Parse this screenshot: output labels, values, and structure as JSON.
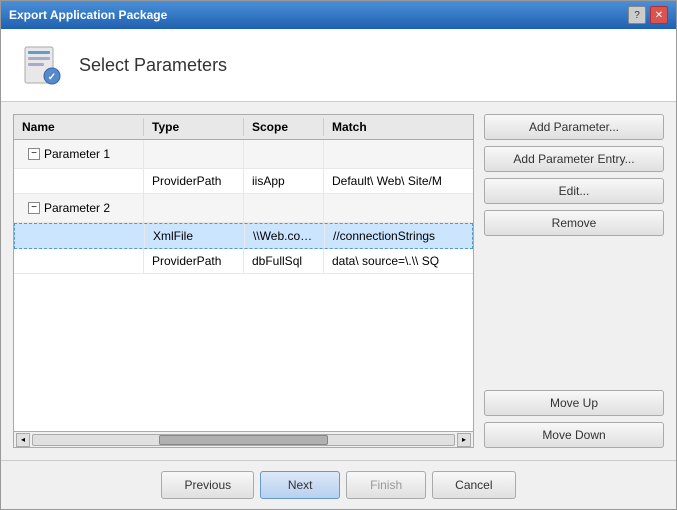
{
  "window": {
    "title": "Export Application Package",
    "help_btn": "?",
    "close_btn": "✕"
  },
  "header": {
    "title": "Select Parameters"
  },
  "table": {
    "columns": [
      "Name",
      "Type",
      "Scope",
      "Match"
    ],
    "groups": [
      {
        "name": "Parameter 1",
        "entries": [
          {
            "type": "ProviderPath",
            "scope": "iisApp",
            "match": "Default\\ Web\\ Site/M"
          }
        ]
      },
      {
        "name": "Parameter 2",
        "entries": [
          {
            "type": "XmlFile",
            "scope": "\\\\Web.confi...",
            "match": "//connectionStrings",
            "selected": true
          },
          {
            "type": "ProviderPath",
            "scope": "dbFullSql",
            "match": "data\\ source=\\.\\\\ SQ"
          }
        ]
      }
    ]
  },
  "buttons": {
    "add_parameter": "Add Parameter...",
    "add_parameter_entry": "Add Parameter Entry...",
    "edit": "Edit...",
    "remove": "Remove",
    "move_up": "Move Up",
    "move_down": "Move Down"
  },
  "footer": {
    "previous": "Previous",
    "next": "Next",
    "finish": "Finish",
    "cancel": "Cancel"
  }
}
